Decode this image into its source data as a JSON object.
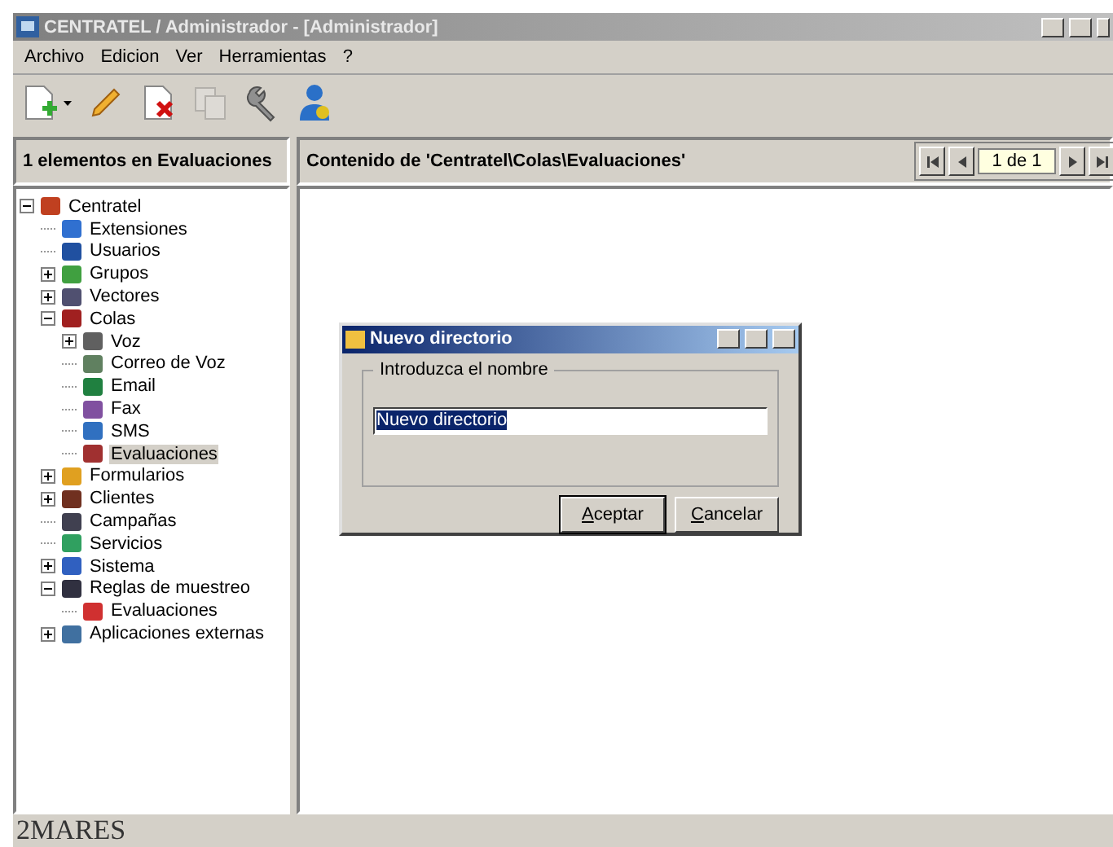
{
  "window": {
    "title": "CENTRATEL / Administrador - [Administrador]"
  },
  "menu": [
    "Archivo",
    "Edicion",
    "Ver",
    "Herramientas",
    "?"
  ],
  "toolbar": [
    {
      "kind": "new",
      "disabled": false
    },
    {
      "kind": "dropdown",
      "disabled": false
    },
    {
      "kind": "edit",
      "disabled": false
    },
    {
      "kind": "delete",
      "disabled": false
    },
    {
      "kind": "copy",
      "disabled": true
    },
    {
      "kind": "tools",
      "disabled": false
    },
    {
      "kind": "user",
      "disabled": false
    }
  ],
  "left_header": "1 elementos en Evaluaciones",
  "right_header": "Contenido de 'Centratel\\Colas\\Evaluaciones'",
  "pager": {
    "value": "1 de 1"
  },
  "tree": [
    {
      "label": "Centratel",
      "expanded": true,
      "selected": false,
      "color": "#c04020",
      "children": [
        {
          "label": "Extensiones",
          "selected": false,
          "color": "#3070d0"
        },
        {
          "label": "Usuarios",
          "selected": false,
          "color": "#2050a0"
        },
        {
          "label": "Grupos",
          "expanded": false,
          "selected": false,
          "color": "#40a040"
        },
        {
          "label": "Vectores",
          "expanded": false,
          "selected": false,
          "color": "#505070"
        },
        {
          "label": "Colas",
          "expanded": true,
          "selected": false,
          "color": "#a02020",
          "children": [
            {
              "label": "Voz",
              "expanded": false,
              "selected": false,
              "color": "#606060"
            },
            {
              "label": "Correo de Voz",
              "selected": false,
              "color": "#608060"
            },
            {
              "label": "Email",
              "selected": false,
              "color": "#208040"
            },
            {
              "label": "Fax",
              "selected": false,
              "color": "#8050a0"
            },
            {
              "label": "SMS",
              "selected": false,
              "color": "#3070c0"
            },
            {
              "label": "Evaluaciones",
              "selected": true,
              "color": "#a03030"
            }
          ]
        },
        {
          "label": "Formularios",
          "expanded": false,
          "selected": false,
          "color": "#e0a020"
        },
        {
          "label": "Clientes",
          "expanded": false,
          "selected": false,
          "color": "#703020"
        },
        {
          "label": "Campañas",
          "selected": false,
          "color": "#404050"
        },
        {
          "label": "Servicios",
          "selected": false,
          "color": "#30a060"
        },
        {
          "label": "Sistema",
          "expanded": false,
          "selected": false,
          "color": "#3060c0"
        },
        {
          "label": "Reglas de muestreo",
          "expanded": true,
          "selected": false,
          "color": "#303040",
          "children": [
            {
              "label": "Evaluaciones",
              "selected": false,
              "color": "#d03030"
            }
          ]
        },
        {
          "label": "Aplicaciones externas",
          "expanded": false,
          "selected": false,
          "color": "#4070a0"
        }
      ]
    }
  ],
  "dialog": {
    "title": "Nuevo directorio",
    "group_label": "Introduzca el nombre",
    "value": "Nuevo directorio",
    "buttons": [
      {
        "label": "Aceptar",
        "default": true
      },
      {
        "label": "Cancelar",
        "default": false
      }
    ]
  },
  "footer": {
    "logo": "2MARES"
  }
}
